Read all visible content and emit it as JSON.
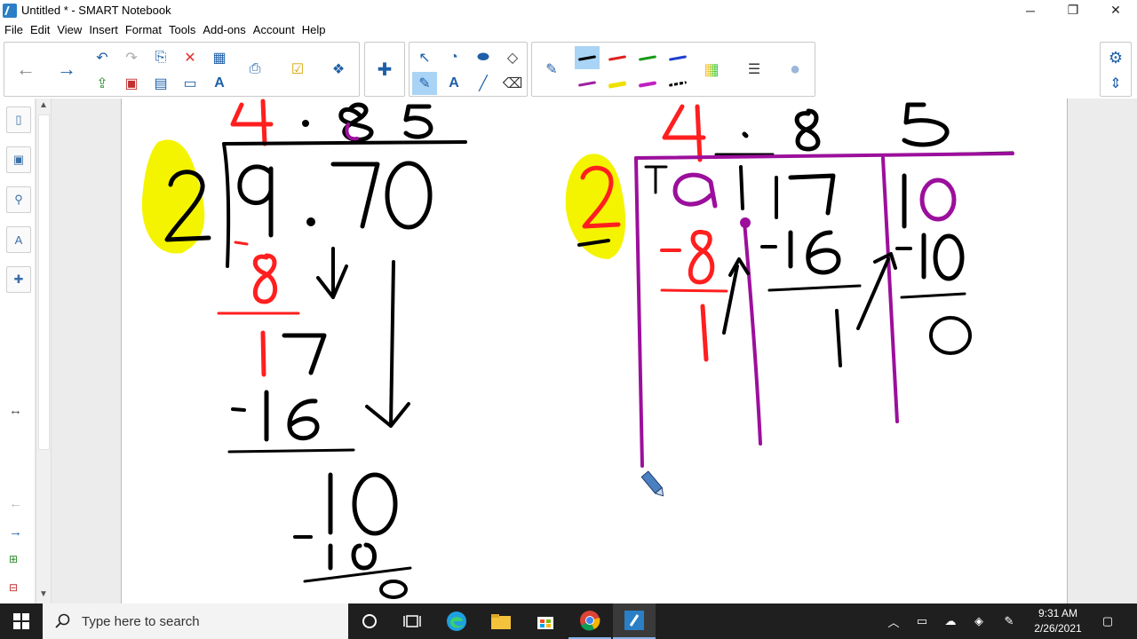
{
  "window": {
    "title": "Untitled * - SMART Notebook",
    "minimize": "─",
    "restore": "❐",
    "close": "✕"
  },
  "menu": [
    "File",
    "Edit",
    "View",
    "Insert",
    "Format",
    "Tools",
    "Add-ons",
    "Account",
    "Help"
  ],
  "toolbar": {
    "selected_pen_color": "#000000",
    "pen_colors_row1": [
      "#000000",
      "#e02020",
      "#1a9a1a",
      "#1f3fd0"
    ],
    "pen_colors_row2": [
      "#a020a0",
      "#f0e000",
      "#c020c0",
      "#000000"
    ]
  },
  "taskbar": {
    "search_placeholder": "Type here to search",
    "time": "9:31 AM",
    "date": "2/26/2021"
  },
  "colors": {
    "ink_black": "#000000",
    "ink_red": "#ff1f1f",
    "ink_purple": "#9c0f9c",
    "highlight_yellow": "#f4f400"
  }
}
